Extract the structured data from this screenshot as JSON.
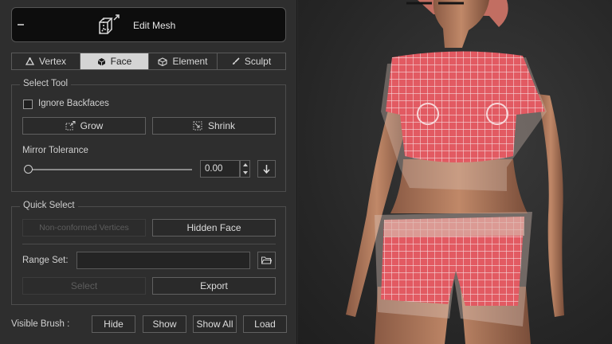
{
  "header": {
    "title": "Edit Mesh",
    "icon": "mesh-cube-icon"
  },
  "tabs": [
    {
      "label": "Vertex",
      "icon": "vertex-icon",
      "active": false
    },
    {
      "label": "Face",
      "icon": "face-cube-icon",
      "active": true
    },
    {
      "label": "Element",
      "icon": "element-icon",
      "active": false
    },
    {
      "label": "Sculpt",
      "icon": "brush-icon",
      "active": false
    }
  ],
  "select_tool": {
    "title": "Select Tool",
    "ignore_backfaces": {
      "label": "Ignore Backfaces",
      "checked": false
    },
    "grow_label": "Grow",
    "shrink_label": "Shrink",
    "mirror_label": "Mirror Tolerance",
    "mirror_value": "0.00",
    "mirror_level": 0
  },
  "quick_select": {
    "title": "Quick Select",
    "non_conformed_label": "Non-conformed Vertices",
    "hidden_face_label": "Hidden Face",
    "range_set_label": "Range Set:",
    "range_set_value": "",
    "select_label": "Select",
    "export_label": "Export"
  },
  "visible_brush": {
    "label": "Visible Brush :",
    "hide_label": "Hide",
    "show_label": "Show",
    "show_all_label": "Show All",
    "load_label": "Load"
  },
  "colors": {
    "panel_bg": "#2e2e2e",
    "active_tab": "#d4d4d4",
    "mesh_highlight": "#e25a62"
  }
}
